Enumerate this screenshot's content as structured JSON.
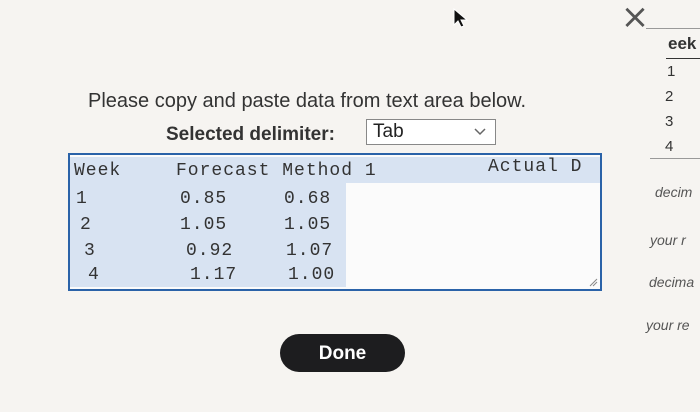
{
  "dialog": {
    "close_glyph": "×",
    "instruction": "Please copy and paste data from text area below.",
    "delimiter_label": "Selected delimiter:",
    "delimiter_value": "Tab",
    "done_label": "Done"
  },
  "textarea": {
    "header": [
      "Week",
      "Forecast Method 1",
      "Actual D"
    ],
    "rows": [
      [
        "1",
        "0.85",
        "0.68"
      ],
      [
        "2",
        "1.05",
        "1.05"
      ],
      [
        "3",
        "0.92",
        "1.07"
      ],
      [
        "4",
        "1.17",
        "1.00"
      ]
    ]
  },
  "side_panel": {
    "header": "eek",
    "weeks": [
      "1",
      "2",
      "3",
      "4"
    ],
    "hints": [
      "decim",
      "your r",
      "decima",
      "your re"
    ]
  }
}
